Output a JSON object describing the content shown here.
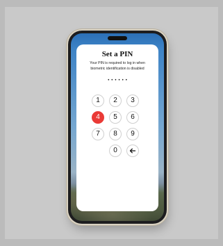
{
  "pin_screen": {
    "title": "Set a PIN",
    "subtitle": "Your PIN is required to log in when biometric identification is disabled",
    "pin_mask": "••••••"
  },
  "keypad": {
    "keys": [
      "1",
      "2",
      "3",
      "4",
      "5",
      "6",
      "7",
      "8",
      "9",
      "0"
    ],
    "active_key": "4",
    "backspace_icon": "arrow-left-icon"
  },
  "colors": {
    "accent": "#ea3a36",
    "sheet": "#ffffff",
    "background": "#c9c9c9"
  }
}
